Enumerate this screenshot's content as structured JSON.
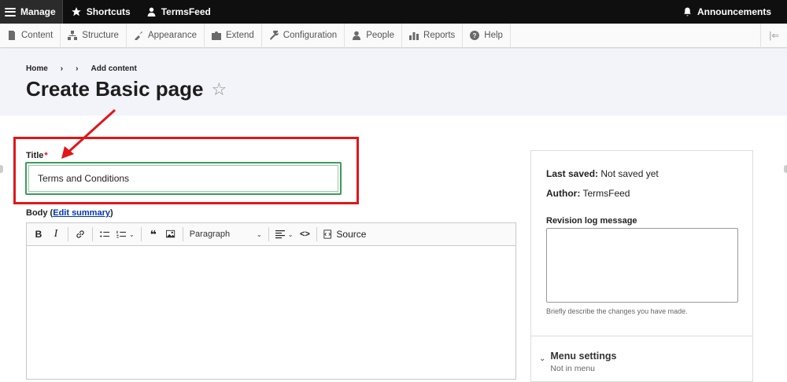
{
  "toolbar": {
    "manage": "Manage",
    "shortcuts": "Shortcuts",
    "user": "TermsFeed",
    "announcements": "Announcements"
  },
  "tray": {
    "items": [
      {
        "label": "Content",
        "icon": "content-icon"
      },
      {
        "label": "Structure",
        "icon": "structure-icon"
      },
      {
        "label": "Appearance",
        "icon": "appearance-icon"
      },
      {
        "label": "Extend",
        "icon": "extend-icon"
      },
      {
        "label": "Configuration",
        "icon": "configuration-icon"
      },
      {
        "label": "People",
        "icon": "people-icon"
      },
      {
        "label": "Reports",
        "icon": "reports-icon"
      },
      {
        "label": "Help",
        "icon": "help-icon"
      }
    ]
  },
  "breadcrumb": {
    "home": "Home",
    "sep": "›",
    "current": "Add content"
  },
  "page": {
    "title": "Create Basic page",
    "star": "☆"
  },
  "form": {
    "title_label": "Title",
    "required_mark": "*",
    "title_value": "Terms and Conditions",
    "body_label": "Body",
    "body_link": "Edit summary"
  },
  "editor": {
    "bold": "B",
    "italic": "I",
    "blockquote": "❝",
    "paragraph": "Paragraph",
    "code": "<>",
    "source": "Source"
  },
  "sidebar": {
    "last_saved_label": "Last saved:",
    "last_saved_value": "Not saved yet",
    "author_label": "Author:",
    "author_value": "TermsFeed",
    "revision_label": "Revision log message",
    "revision_help": "Briefly describe the changes you have made.",
    "menu_title": "Menu settings",
    "menu_sub": "Not in menu"
  },
  "colors": {
    "annotation_red": "#e0161b",
    "focus_green": "#3b9c5c",
    "link_blue": "#0036b1"
  }
}
